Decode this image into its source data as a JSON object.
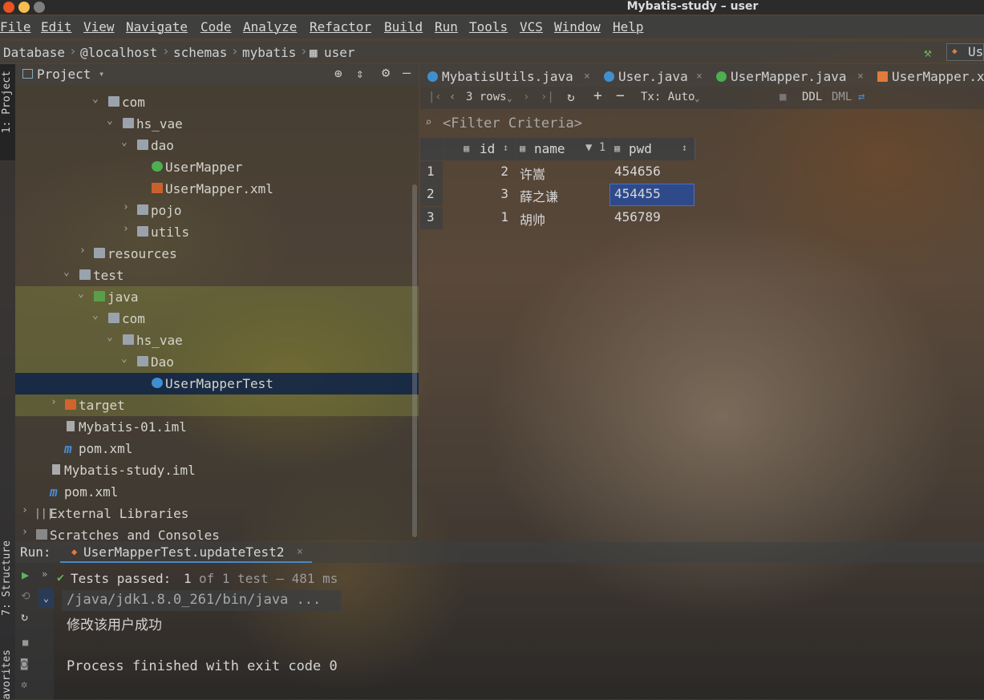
{
  "window": {
    "title": "Mybatis-study – user",
    "dots": [
      "#e95420",
      "#f5bf4f",
      "#7e7e7e"
    ]
  },
  "menu": [
    "File",
    "Edit",
    "View",
    "Navigate",
    "Code",
    "Analyze",
    "Refactor",
    "Build",
    "Run",
    "Tools",
    "VCS",
    "Window",
    "Help"
  ],
  "breadcrumb": [
    "Database",
    "@localhost",
    "schemas",
    "mybatis",
    "user"
  ],
  "toolbar_right": {
    "run_config": "Us"
  },
  "left_strip": {
    "project": "1: Project",
    "structure": "7: Structure",
    "favorites": "avorites"
  },
  "project": {
    "title": "Project",
    "tree": [
      {
        "label": "com",
        "type": "package",
        "expanded": true
      },
      {
        "label": "hs_vae",
        "type": "package",
        "expanded": true
      },
      {
        "label": "dao",
        "type": "package",
        "expanded": true
      },
      {
        "label": "UserMapper",
        "type": "interface"
      },
      {
        "label": "UserMapper.xml",
        "type": "xml"
      },
      {
        "label": "pojo",
        "type": "package",
        "expanded": false
      },
      {
        "label": "utils",
        "type": "package",
        "expanded": false
      },
      {
        "label": "resources",
        "type": "resources",
        "expanded": false
      },
      {
        "label": "test",
        "type": "folder",
        "expanded": true
      },
      {
        "label": "java",
        "type": "test-source",
        "expanded": true
      },
      {
        "label": "com",
        "type": "package",
        "expanded": true
      },
      {
        "label": "hs_vae",
        "type": "package",
        "expanded": true
      },
      {
        "label": "Dao",
        "type": "package",
        "expanded": true
      },
      {
        "label": "UserMapperTest",
        "type": "class",
        "selected": true
      },
      {
        "label": "target",
        "type": "excluded",
        "expanded": false
      },
      {
        "label": "Mybatis-01.iml",
        "type": "iml"
      },
      {
        "label": "pom.xml",
        "type": "maven"
      },
      {
        "label": "Mybatis-study.iml",
        "type": "iml"
      },
      {
        "label": "pom.xml",
        "type": "maven"
      },
      {
        "label": "External Libraries",
        "type": "libraries",
        "expanded": false
      },
      {
        "label": "Scratches and Consoles",
        "type": "scratches",
        "expanded": false
      }
    ]
  },
  "editor_tabs": [
    {
      "label": "MybatisUtils.java",
      "icon_color": "#3f8fcf"
    },
    {
      "label": "User.java",
      "icon_color": "#3f8fcf"
    },
    {
      "label": "UserMapper.java",
      "icon_color": "#4caf50"
    },
    {
      "label": "UserMapper.x",
      "icon_color": "#e07b39"
    }
  ],
  "db_toolbar": {
    "rows": "3 rows",
    "tx": "Tx: Auto",
    "ddl": "DDL",
    "dml": "DML"
  },
  "filter": {
    "placeholder": "<Filter Criteria>"
  },
  "grid": {
    "columns": [
      {
        "name": "id",
        "sort": "↕"
      },
      {
        "name": "name",
        "sort": "▼ 1"
      },
      {
        "name": "pwd",
        "sort": "↕"
      }
    ],
    "rows": [
      {
        "num": "1",
        "id": "2",
        "name": "许嵩",
        "pwd": "454656"
      },
      {
        "num": "2",
        "id": "3",
        "name": "薛之谦",
        "pwd": "454455"
      },
      {
        "num": "3",
        "id": "1",
        "name": "胡帅",
        "pwd": "456789"
      }
    ]
  },
  "run": {
    "label": "Run:",
    "tab": "UserMapperTest.updateTest2",
    "status_prefix": "Tests passed:",
    "status_count": "1",
    "status_suffix": "of 1 test — 481 ms",
    "output": [
      "/java/jdk1.8.0_261/bin/java ...",
      "修改该用户成功",
      "",
      "Process finished with exit code 0"
    ]
  },
  "colors": {
    "selection": "#2f4a8a",
    "pass": "#5fb35f",
    "folder": "#9aa3ad"
  }
}
